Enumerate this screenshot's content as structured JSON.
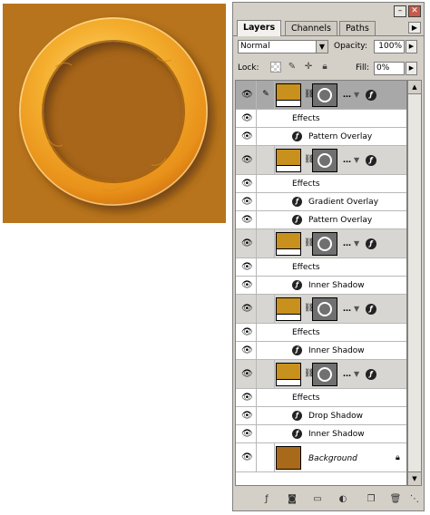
{
  "window": {
    "minimize_label": "–",
    "close_label": "✕"
  },
  "tabs": [
    {
      "label": "Layers",
      "active": true
    },
    {
      "label": "Channels",
      "active": false
    },
    {
      "label": "Paths",
      "active": false
    }
  ],
  "tab_menu_icon": "flyout-menu-icon",
  "options": {
    "blend_mode": "Normal",
    "opacity_label": "Opacity:",
    "opacity_value": "100%",
    "lock_label": "Lock:",
    "fill_label": "Fill:",
    "fill_value": "0%"
  },
  "layers": [
    {
      "selected": true,
      "effects_label": "Effects",
      "effects": [
        "Pattern Overlay"
      ]
    },
    {
      "selected": false,
      "effects_label": "Effects",
      "effects": [
        "Gradient Overlay",
        "Pattern Overlay"
      ]
    },
    {
      "selected": false,
      "effects_label": "Effects",
      "effects": [
        "Inner Shadow"
      ]
    },
    {
      "selected": false,
      "effects_label": "Effects",
      "effects": [
        "Inner Shadow"
      ]
    },
    {
      "selected": false,
      "effects_label": "Effects",
      "effects": [
        "Drop Shadow",
        "Inner Shadow"
      ]
    }
  ],
  "background_layer": {
    "name": "Background"
  },
  "colors": {
    "canvas": "#B8741C",
    "ring": "#F0A020",
    "layer_fill_thumb": "#C8901C",
    "background_thumb": "#A86A1A"
  },
  "footer_icons": [
    "link-layers-icon",
    "add-style-icon",
    "add-mask-icon",
    "new-group-icon",
    "adjustment-layer-icon",
    "new-layer-icon",
    "delete-layer-icon"
  ]
}
